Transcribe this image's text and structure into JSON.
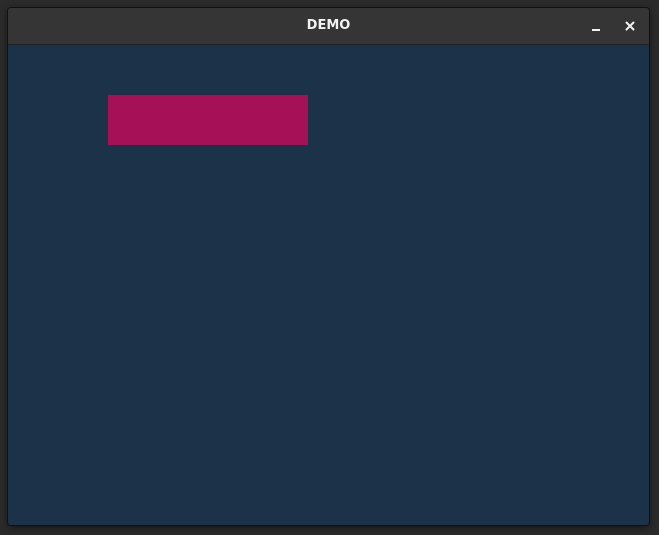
{
  "window": {
    "title": "DEMO",
    "background_color": "#1b3249",
    "titlebar_color": "#353535"
  },
  "titlebar_buttons": {
    "minimize_icon": "minimize-icon",
    "close_icon": "close-icon"
  },
  "canvas": {
    "rectangle_color": "#a61056"
  }
}
